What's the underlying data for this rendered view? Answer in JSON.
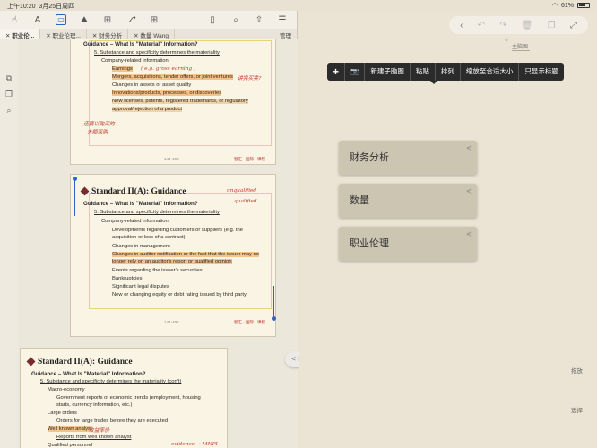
{
  "status": {
    "time": "上午10:20",
    "date": "3月25日周四",
    "battery": "61%"
  },
  "left_toolbar": {
    "icons": [
      "hand-icon",
      "text-icon",
      "select-icon",
      "image-icon",
      "zoom-icon",
      "branch-icon",
      "grid-icon",
      "panel-icon",
      "search-icon",
      "share-icon",
      "more-icon"
    ]
  },
  "tabs": [
    {
      "label": "职业伦...",
      "active": true
    },
    {
      "label": "职业伦理..."
    },
    {
      "label": "财务分析"
    },
    {
      "label": "数量 Wang"
    },
    {
      "label": "管理",
      "manage": true
    }
  ],
  "page1": {
    "header": "Guidance – What Is \"Material\" Information?",
    "lines": [
      "5.   Substance and specificity determines the materiality",
      "Company-related information",
      "Earnings",
      "Mergers, acquisitions, tender offers, or joint ventures",
      "Changes in assets or asset quality",
      "Innovations/products, processes, or discoveries",
      "New licenses, patents, registered trademarks, or regulatory",
      "approval/rejection of a product"
    ],
    "ink_notes": [
      "( e.g. gross earning )",
      "讲完买卖?",
      "还要以购买的",
      "大额采购"
    ],
    "footer_num": "144-498",
    "footer_brand": "智汇 · 国际 · 课程"
  },
  "page2": {
    "title": "Standard II(A): Guidance",
    "header": "Guidance – What Is \"Material\" Information?",
    "lines": [
      "5.   Substance and specificity determines the materiality",
      "Company-related information",
      "Developments regarding customers or suppliers (e.g. the",
      "acquisition or loss of a contract)",
      "Changes in management",
      "Changes in auditor notification or the fact that the issuer may no",
      "longer rely on an auditor's report or qualified opinion",
      "Events regarding the issuer's securities",
      "Bankruptcies",
      "Significant legal disputes",
      "New or changing equity or debt rating issued by third party"
    ],
    "ink_notes": [
      "unqualified",
      "qualified"
    ],
    "footer_num": "144-498",
    "footer_brand": "智汇 · 国际 · 课程"
  },
  "page3": {
    "title": "Standard II(A): Guidance",
    "header": "Guidance – What Is \"Material\" Information?",
    "lines": [
      "5.   Substance and specificity determines the materiality (con't)",
      "Macro-economy",
      "Government reports of economic trends (employment, housing",
      "starts, currency information, etc.)",
      "Large orders",
      "Orders for large trades before they are executed",
      "Well known analyst",
      "Reports from well known analyst",
      "Qualified personnel"
    ],
    "ink_notes": [
      "收益率价",
      "evidence → MNPI"
    ]
  },
  "nav": {
    "label": "< >"
  },
  "right_toolbar": {
    "icons": [
      "back-icon",
      "undo-icon",
      "redo-icon",
      "trash-icon",
      "copy-icon",
      "expand-icon"
    ]
  },
  "map_title": "主脑图",
  "context_menu": {
    "items": [
      "+",
      "📷",
      "新建子脑图",
      "粘贴",
      "排列",
      "缩放至合适大小",
      "只显示标题"
    ]
  },
  "nodes": [
    {
      "label": "财务分析"
    },
    {
      "label": "数量"
    },
    {
      "label": "职业伦理"
    }
  ],
  "side_buttons": {
    "zoom": "拖放",
    "select": "选择"
  }
}
